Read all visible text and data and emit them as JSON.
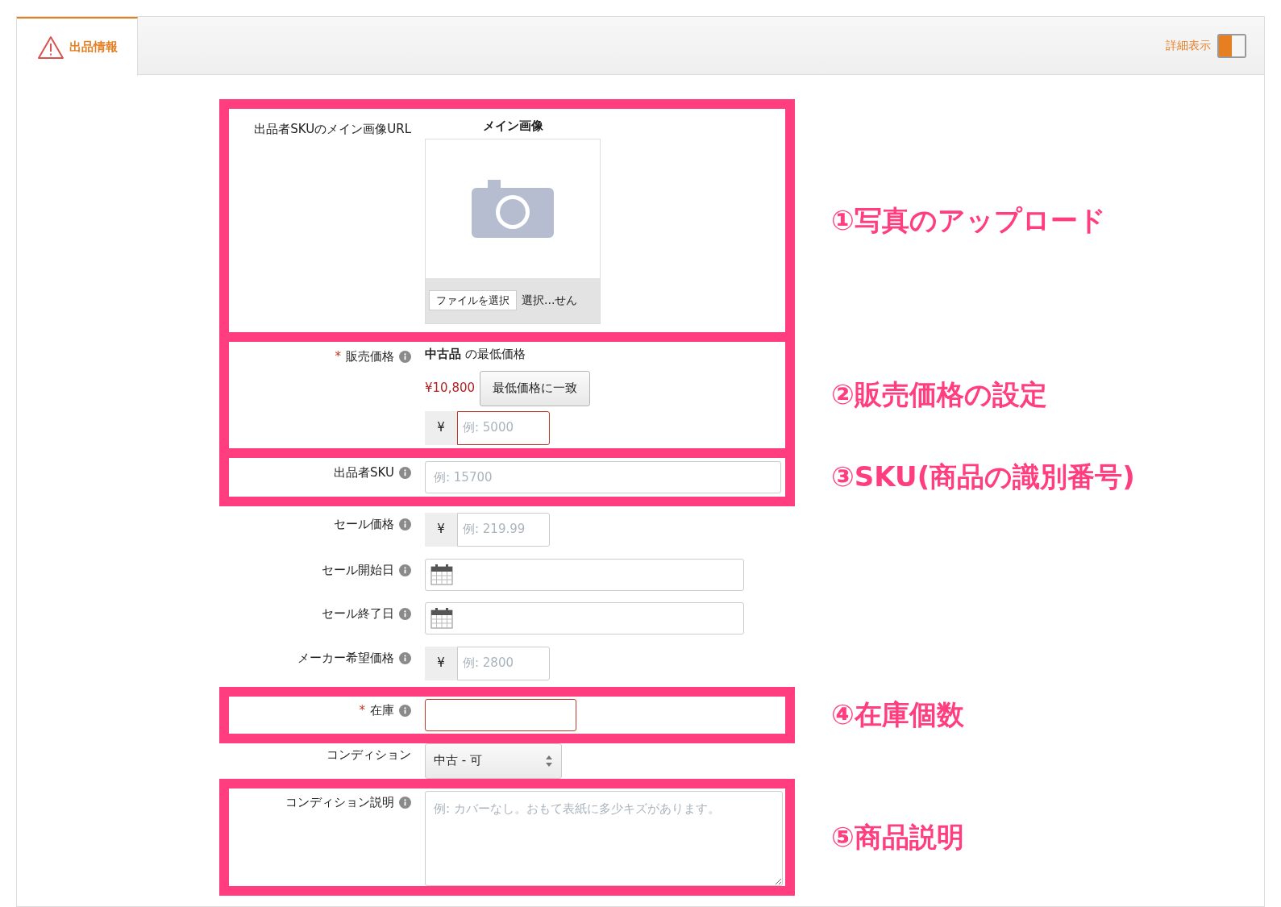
{
  "tabs": [
    {
      "label": "出品情報",
      "selected": true
    }
  ],
  "detail_toggle": {
    "label": "詳細表示",
    "on": true
  },
  "sections": [
    {
      "annotation": "①写真のアップロード",
      "rows": [
        {
          "kind": "image",
          "label": "出品者SKUのメイン画像URL",
          "heading": "メイン画像",
          "button": "ファイルを選択",
          "file_status": "選択...せん"
        }
      ]
    },
    {
      "annotation": "②販売価格の設定",
      "rows": [
        {
          "kind": "min_price",
          "label": "販売価格",
          "marker": "*",
          "info": true,
          "caption": "**中古品** の最低価格",
          "price": "¥10,800",
          "button": "最低価格に一致",
          "currency": "¥",
          "placeholder": "例: 5000",
          "error": true
        }
      ]
    },
    {
      "annotation": "③SKU(商品の識別番号)",
      "rows": [
        {
          "kind": "text",
          "label": "出品者SKU",
          "info": true,
          "placeholder": "例: 15700",
          "error": false
        }
      ]
    },
    {
      "rows": [
        {
          "kind": "currency",
          "label": "セール価格",
          "info": true,
          "currency": "¥",
          "placeholder": "例: 219.99",
          "error": false
        },
        {
          "kind": "date",
          "label": "セール開始日",
          "info": true
        },
        {
          "kind": "date",
          "label": "セール終了日",
          "info": true
        },
        {
          "kind": "currency",
          "label": "メーカー希望価格",
          "info": true,
          "currency": "¥",
          "placeholder": "例: 2800",
          "error": false
        }
      ]
    },
    {
      "annotation": "④在庫個数",
      "rows": [
        {
          "kind": "short",
          "label": "在庫",
          "marker": "*",
          "info": true,
          "error": true
        }
      ]
    },
    {
      "rows": [
        {
          "kind": "select",
          "label": "コンディション",
          "info": false,
          "value": "中古 - 可"
        }
      ]
    },
    {
      "annotation": "⑤商品説明",
      "rows": [
        {
          "kind": "textarea",
          "label": "コンディション説明",
          "info": true,
          "placeholder": "例: カバーなし。おもて表紙に多少キズがあります。"
        }
      ]
    }
  ]
}
